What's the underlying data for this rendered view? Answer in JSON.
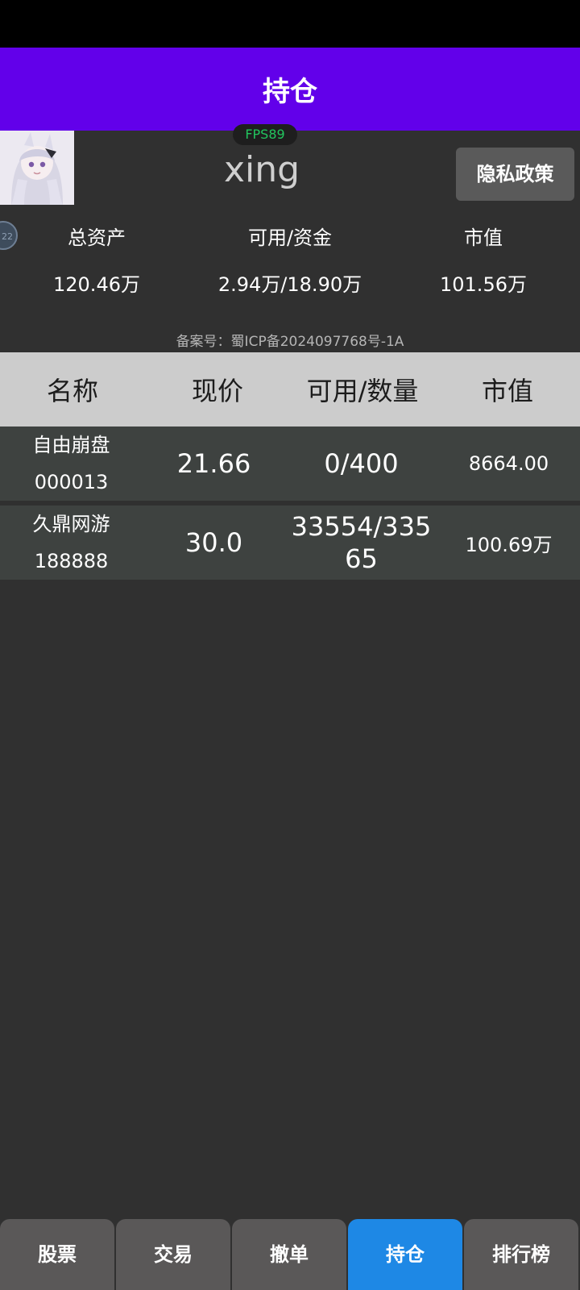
{
  "theme": {
    "title_bar_color": "#6200ea",
    "tab_active_color": "#1e88e5",
    "tab_inactive_color": "#5a5858",
    "fps_color": "#22c55e"
  },
  "header": {
    "title": "持仓"
  },
  "profile": {
    "fps_badge": "FPS89",
    "username": "xing",
    "privacy_button": "隐私政策",
    "side_badge": "22"
  },
  "summary": {
    "labels": [
      "总资产",
      "可用/资金",
      "市值"
    ],
    "values": [
      "120.46万",
      "2.94万/18.90万",
      "101.56万"
    ]
  },
  "icp": "备案号：蜀ICP备2024097768号-1A",
  "table": {
    "headers": [
      "名称",
      "现价",
      "可用/数量",
      "市值"
    ],
    "rows": [
      {
        "name": "自由崩盘",
        "code": "000013",
        "price": "21.66",
        "quantity": "0/400",
        "market_value": "8664.00"
      },
      {
        "name": "久鼎网游",
        "code": "188888",
        "price": "30.0",
        "quantity": "33554/33565",
        "market_value": "100.69万"
      }
    ]
  },
  "tabs": [
    {
      "label": "股票",
      "active": false
    },
    {
      "label": "交易",
      "active": false
    },
    {
      "label": "撤单",
      "active": false
    },
    {
      "label": "持仓",
      "active": true
    },
    {
      "label": "排行榜",
      "active": false
    }
  ]
}
